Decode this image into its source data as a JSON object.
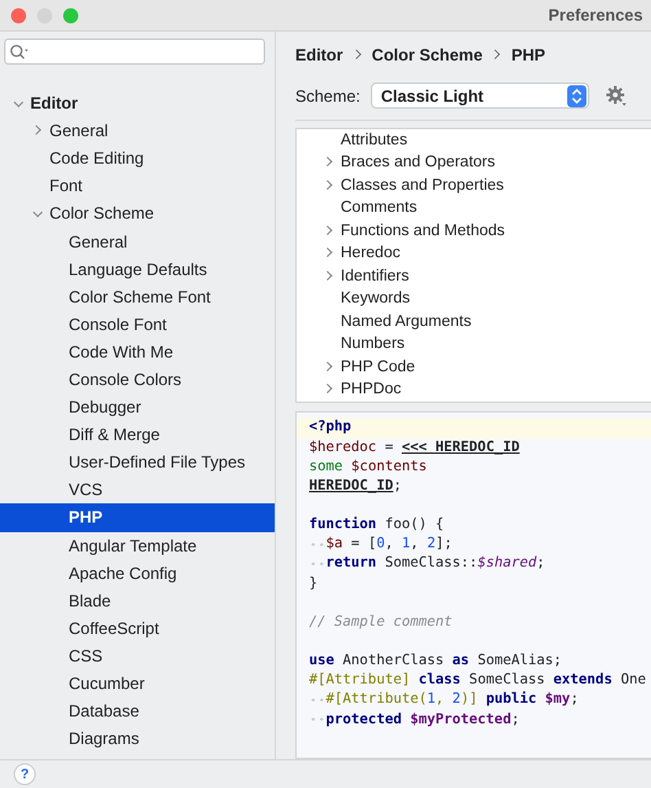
{
  "window": {
    "title": "Preferences"
  },
  "help": {
    "label": "?"
  },
  "sidebar": {
    "items": [
      {
        "label": "Editor",
        "expanded": true,
        "selected": false,
        "children": [
          {
            "label": "General",
            "expanded": false,
            "selected": false
          },
          {
            "label": "Code Editing",
            "selected": false
          },
          {
            "label": "Font",
            "selected": false
          },
          {
            "label": "Color Scheme",
            "expanded": true,
            "selected": false,
            "children": [
              {
                "label": "General",
                "selected": false
              },
              {
                "label": "Language Defaults",
                "selected": false
              },
              {
                "label": "Color Scheme Font",
                "selected": false
              },
              {
                "label": "Console Font",
                "selected": false
              },
              {
                "label": "Code With Me",
                "selected": false
              },
              {
                "label": "Console Colors",
                "selected": false
              },
              {
                "label": "Debugger",
                "selected": false
              },
              {
                "label": "Diff & Merge",
                "selected": false
              },
              {
                "label": "User-Defined File Types",
                "selected": false
              },
              {
                "label": "VCS",
                "selected": false
              },
              {
                "label": "PHP",
                "selected": true
              },
              {
                "label": "Angular Template",
                "selected": false
              },
              {
                "label": "Apache Config",
                "selected": false
              },
              {
                "label": "Blade",
                "selected": false
              },
              {
                "label": "CoffeeScript",
                "selected": false
              },
              {
                "label": "CSS",
                "selected": false
              },
              {
                "label": "Cucumber",
                "selected": false
              },
              {
                "label": "Database",
                "selected": false
              },
              {
                "label": "Diagrams",
                "selected": false
              }
            ]
          }
        ]
      }
    ]
  },
  "breadcrumb": [
    "Editor",
    "Color Scheme",
    "PHP"
  ],
  "scheme": {
    "label": "Scheme:",
    "value": "Classic Light"
  },
  "categories": [
    {
      "label": "Attributes",
      "kind": "leaf"
    },
    {
      "label": "Braces and Operators",
      "kind": "group"
    },
    {
      "label": "Classes and Properties",
      "kind": "group"
    },
    {
      "label": "Comments",
      "kind": "leaf"
    },
    {
      "label": "Functions and Methods",
      "kind": "group"
    },
    {
      "label": "Heredoc",
      "kind": "group"
    },
    {
      "label": "Identifiers",
      "kind": "group"
    },
    {
      "label": "Keywords",
      "kind": "leaf"
    },
    {
      "label": "Named Arguments",
      "kind": "leaf"
    },
    {
      "label": "Numbers",
      "kind": "leaf"
    },
    {
      "label": "PHP Code",
      "kind": "group"
    },
    {
      "label": "PHPDoc",
      "kind": "group"
    }
  ],
  "code": [
    {
      "current": true,
      "tokens": [
        {
          "kind": "keyword",
          "text": "<?php"
        }
      ]
    },
    {
      "current": false,
      "tokens": [
        {
          "kind": "var",
          "text": "$heredoc"
        },
        {
          "kind": "plain",
          "text": " = "
        },
        {
          "kind": "heredoc_id",
          "text": "<<< HEREDOC_ID"
        }
      ]
    },
    {
      "current": false,
      "tokens": [
        {
          "kind": "string",
          "text": "some "
        },
        {
          "kind": "var",
          "text": "$contents"
        }
      ]
    },
    {
      "current": false,
      "tokens": [
        {
          "kind": "heredoc_id",
          "text": "HEREDOC_ID"
        },
        {
          "kind": "plain",
          "text": ";"
        }
      ]
    },
    {
      "current": false
    },
    {
      "current": false,
      "tokens": [
        {
          "kind": "keyword",
          "text": "function"
        },
        {
          "kind": "plain",
          "text": " foo() {"
        }
      ]
    },
    {
      "current": false,
      "tokens": [
        {
          "kind": "indent"
        },
        {
          "kind": "var",
          "text": "$a"
        },
        {
          "kind": "plain",
          "text": " = ["
        },
        {
          "kind": "number",
          "text": "0"
        },
        {
          "kind": "plain",
          "text": ", "
        },
        {
          "kind": "number",
          "text": "1"
        },
        {
          "kind": "plain",
          "text": ", "
        },
        {
          "kind": "number",
          "text": "2"
        },
        {
          "kind": "plain",
          "text": "];"
        }
      ]
    },
    {
      "current": false,
      "tokens": [
        {
          "kind": "indent"
        },
        {
          "kind": "keyword",
          "text": "return"
        },
        {
          "kind": "plain",
          "text": " SomeClass::"
        },
        {
          "kind": "static",
          "text": "$shared"
        },
        {
          "kind": "plain",
          "text": ";"
        }
      ]
    },
    {
      "current": false,
      "tokens": [
        {
          "kind": "plain",
          "text": "}"
        }
      ]
    },
    {
      "current": false
    },
    {
      "current": false,
      "tokens": [
        {
          "kind": "comment",
          "text": "// Sample comment"
        }
      ]
    },
    {
      "current": false
    },
    {
      "current": false,
      "tokens": [
        {
          "kind": "keyword",
          "text": "use"
        },
        {
          "kind": "plain",
          "text": " AnotherClass "
        },
        {
          "kind": "keyword",
          "text": "as"
        },
        {
          "kind": "plain",
          "text": " SomeAlias;"
        }
      ]
    },
    {
      "current": false,
      "tokens": [
        {
          "kind": "attribute",
          "text": "#[Attribute]"
        },
        {
          "kind": "keyword",
          "text": " class"
        },
        {
          "kind": "plain",
          "text": " SomeClass "
        },
        {
          "kind": "keyword",
          "text": "extends"
        },
        {
          "kind": "plain",
          "text": " One"
        }
      ]
    },
    {
      "current": false,
      "tokens": [
        {
          "kind": "indent"
        },
        {
          "kind": "attribute",
          "text": "#[Attribute("
        },
        {
          "kind": "number",
          "text": "1"
        },
        {
          "kind": "attribute",
          "text": ", "
        },
        {
          "kind": "number",
          "text": "2"
        },
        {
          "kind": "attribute",
          "text": ")]"
        },
        {
          "kind": "keyword",
          "text": " public"
        },
        {
          "kind": "field",
          "text": " $my"
        },
        {
          "kind": "plain",
          "text": ";"
        }
      ]
    },
    {
      "current": false,
      "tokens": [
        {
          "kind": "indent"
        },
        {
          "kind": "keyword",
          "text": "protected"
        },
        {
          "kind": "field",
          "text": " $myProtected"
        },
        {
          "kind": "plain",
          "text": ";"
        }
      ]
    }
  ]
}
